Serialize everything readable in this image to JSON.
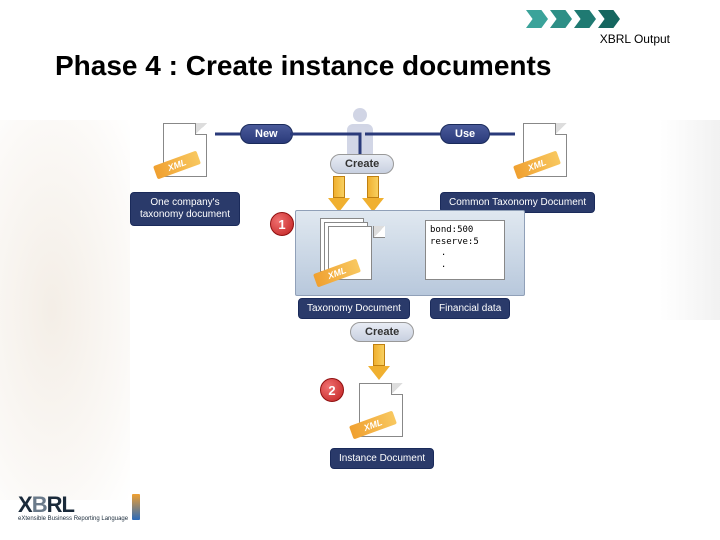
{
  "header": {
    "tag": "XBRL Output"
  },
  "title": "Phase 4 : Create instance documents",
  "actions": {
    "new": "New",
    "use": "Use",
    "create": "Create"
  },
  "labels": {
    "company_taxonomy": "One company's\ntaxonomy document",
    "common_taxonomy": "Common Taxonomy Document",
    "taxonomy_doc": "Taxonomy Document",
    "financial_data": "Financial data",
    "instance_doc": "Instance Document"
  },
  "badges": {
    "one": "1",
    "two": "2"
  },
  "xml": "XML",
  "financial_sample": "bond:500\nreserve:5\n  .\n  .",
  "logo": {
    "main": "XBRL",
    "sub": "eXtensible Business Reporting Language"
  }
}
